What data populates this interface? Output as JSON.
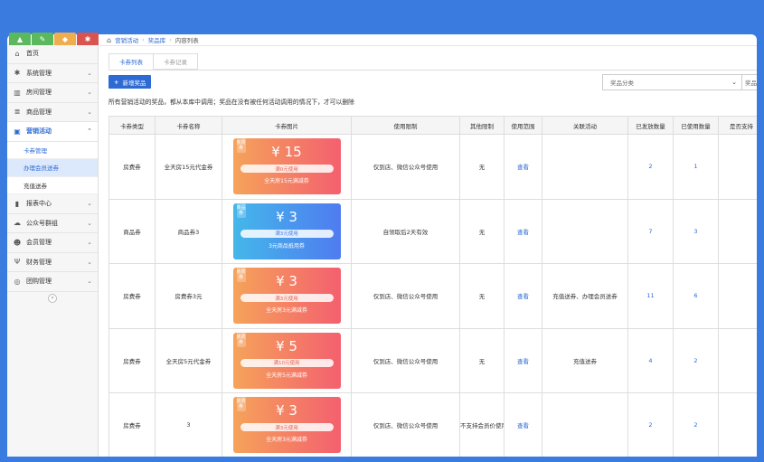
{
  "toolbar": {
    "buttons": [
      {
        "icon": "chart-icon",
        "glyph": "▲",
        "color": "#5cb85c"
      },
      {
        "icon": "pencil-icon",
        "glyph": "✎",
        "color": "#5cb85c"
      },
      {
        "icon": "shirt-icon",
        "glyph": "◆",
        "color": "#f0ad4e"
      },
      {
        "icon": "gear-icon",
        "glyph": "✱",
        "color": "#d9534f"
      }
    ]
  },
  "sidebar": {
    "items": [
      {
        "label": "首页",
        "icon": "home-icon",
        "glyph": "⌂",
        "chevron": false
      },
      {
        "label": "系统管理",
        "icon": "gear-icon",
        "glyph": "✱",
        "chevron": true
      },
      {
        "label": "房间管理",
        "icon": "building-icon",
        "glyph": "▥",
        "chevron": true
      },
      {
        "label": "商品管理",
        "icon": "database-icon",
        "glyph": "≣",
        "chevron": true
      },
      {
        "label": "营销活动",
        "icon": "briefcase-icon",
        "glyph": "▣",
        "chevron": true,
        "active": true
      }
    ],
    "sub_items": [
      {
        "label": "卡券管理",
        "state": "cur"
      },
      {
        "label": "办理会员送券",
        "state": "hl"
      },
      {
        "label": "充值送券",
        "state": ""
      }
    ],
    "items_after": [
      {
        "label": "报表中心",
        "icon": "bar-chart-icon",
        "glyph": "▮",
        "chevron": true
      },
      {
        "label": "公众号群组",
        "icon": "cloud-icon",
        "glyph": "☁",
        "chevron": true
      },
      {
        "label": "会员管理",
        "icon": "users-icon",
        "glyph": "☻",
        "chevron": true
      },
      {
        "label": "财务管理",
        "icon": "cutlery-icon",
        "glyph": "Ψ",
        "chevron": true
      },
      {
        "label": "团购管理",
        "icon": "lifebuoy-icon",
        "glyph": "◎",
        "chevron": true
      }
    ],
    "collapse_glyph": "«"
  },
  "breadcrumb": {
    "home_glyph": "⌂",
    "parts": [
      "营销活动",
      "奖品库",
      "内容列表"
    ]
  },
  "tabs": [
    "卡券列表",
    "卡券记录"
  ],
  "add_button": "新增奖品",
  "add_glyph": "+",
  "select": {
    "placeholder": "奖品分类",
    "second": "奖品"
  },
  "notice": "所有营销活动的奖品，都从本库中调用；奖品在没有被任何活动调用的情况下，才可以删除",
  "table": {
    "headers": [
      "卡券类型",
      "卡券名称",
      "卡券图片",
      "使用限制",
      "其他限制",
      "使用范围",
      "关联活动",
      "已发放数量",
      "已使用数量",
      "是否支持"
    ],
    "rows": [
      {
        "type": "房费券",
        "name": "全天房15元代金券",
        "coupon": {
          "style": "red",
          "tag": "房费券",
          "amount": "¥ 15",
          "cond": "满0元使用",
          "desc": "全天房15元满减券"
        },
        "limit": "仅到店、微信公众号使用",
        "other": "无",
        "scope": "查看",
        "activity": "",
        "issued": "2",
        "used": "1"
      },
      {
        "type": "商品券",
        "name": "商品券3",
        "coupon": {
          "style": "blue",
          "tag": "商品券",
          "amount": "¥ 3",
          "cond": "满3元使用",
          "desc": "3元商品抵用券"
        },
        "limit": "自领取后2天有效",
        "other": "无",
        "scope": "查看",
        "activity": "",
        "issued": "7",
        "used": "3"
      },
      {
        "type": "房费券",
        "name": "房费券3元",
        "coupon": {
          "style": "red",
          "tag": "房费券",
          "amount": "¥ 3",
          "cond": "满3元使用",
          "desc": "全天房3元满减券"
        },
        "limit": "仅到店、微信公众号使用",
        "other": "无",
        "scope": "查看",
        "activity": "充值送券、办理会员送券",
        "issued": "11",
        "used": "6"
      },
      {
        "type": "房费券",
        "name": "全天房5元代金券",
        "coupon": {
          "style": "red",
          "tag": "房费券",
          "amount": "¥ 5",
          "cond": "满10元使用",
          "desc": "全天房5元满减券"
        },
        "limit": "仅到店、微信公众号使用",
        "other": "无",
        "scope": "查看",
        "activity": "充值送券",
        "issued": "4",
        "used": "2"
      },
      {
        "type": "房费券",
        "name": "3",
        "coupon": {
          "style": "red",
          "tag": "房费券",
          "amount": "¥ 3",
          "cond": "满3元使用",
          "desc": "全天房3元满减券"
        },
        "limit": "仅到店、微信公众号使用",
        "other": "不支持会员价使用",
        "scope": "查看",
        "activity": "",
        "issued": "2",
        "used": "2"
      }
    ]
  }
}
